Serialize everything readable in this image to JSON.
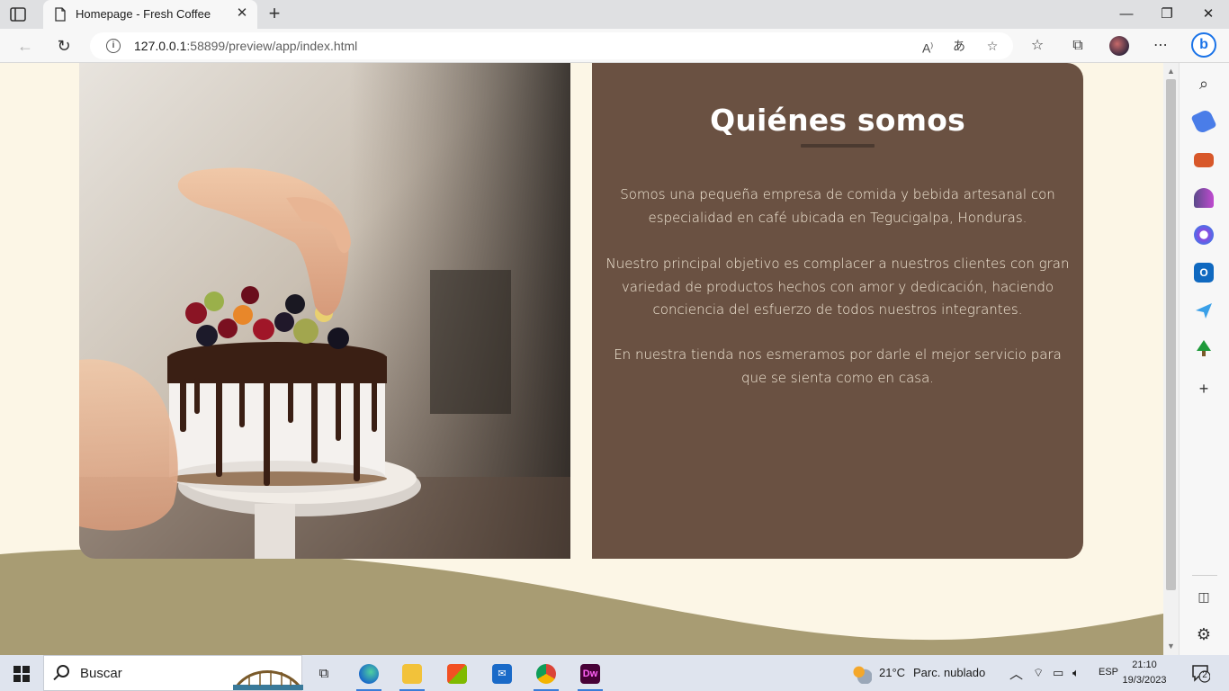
{
  "browser": {
    "tab_title": "Homepage - Fresh Coffee",
    "url_host": "127.0.0.1",
    "url_rest": ":58899/preview/app/index.html"
  },
  "page": {
    "title": "Quiénes somos",
    "paragraphs": [
      "Somos una pequeña empresa de comida y bebida artesanal con especialidad en café ubicada en Tegucigalpa, Honduras.",
      "Nuestro principal objetivo es complacer a nuestros clientes con gran variedad de productos hechos con amor y dedicación, haciendo conciencia del esfuerzo de todos nuestros integrantes.",
      "En nuestra tienda nos esmeramos por darle el mejor servicio para que se sienta como en casa."
    ],
    "image": "cake-with-chocolate-drip-and-fruit-photo",
    "colors": {
      "background": "#fcf6e6",
      "card": "#6a5142",
      "wave": "#a89c73"
    }
  },
  "taskbar": {
    "search_label": "Buscar",
    "weather": "21°C",
    "weather_desc": "Parc. nublado",
    "language": "ESP",
    "time": "21:10",
    "date": "19/3/2023",
    "notifications": "2"
  }
}
